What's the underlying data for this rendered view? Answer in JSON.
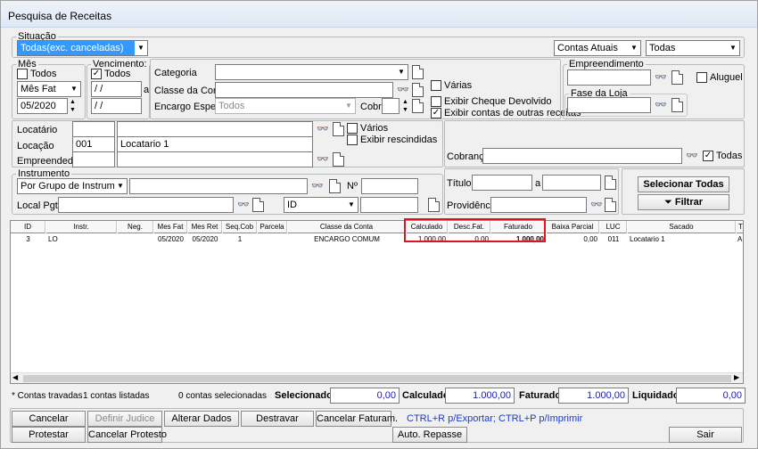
{
  "window": {
    "title": "Pesquisa de Receitas"
  },
  "situacao": {
    "legend": "Situação",
    "value": "Todas(exc. canceladas)",
    "contas_value": "Contas Atuais",
    "todas_value": "Todas"
  },
  "mes": {
    "legend": "Mês",
    "todos_label": "Todos",
    "tipo_value": "Mês Fat",
    "mes_value": "05/2020"
  },
  "vencimento": {
    "legend": "Vencimento:",
    "todos_label": "Todos",
    "de_value": "/ /",
    "ate_sep": "a",
    "ate_value": "/ /"
  },
  "categoria": {
    "categoria_label": "Categoria",
    "classe_label": "Classe da Conta",
    "encargo_label": "Encargo Espec.",
    "encargo_value": "Todos",
    "cobr_label": "Cobr",
    "varias_label": "Várias",
    "cheque_label": "Exibir Cheque Devolvido",
    "outras_label": "Exibir contas de outras receitas"
  },
  "empreendimento": {
    "legend": "Empreendimento",
    "aluguel_label": "Aluguel",
    "fase_legend": "Fase da Loja"
  },
  "locatario": {
    "locatario_label": "Locatário",
    "locacao_label": "Locação",
    "locacao_id": "001",
    "locacao_name": "Locatario 1",
    "empreendedor_label": "Empreendedor",
    "varios_label": "Vários",
    "rescindidas_label": "Exibir rescindidas"
  },
  "cobranca": {
    "label": "Cobrança",
    "todas_label": "Todas"
  },
  "instrumento": {
    "legend": "Instrumento",
    "value": "Por Grupo de Instrumento",
    "numero_label": "Nº",
    "local_label": "Local Pgto",
    "id_value": "ID"
  },
  "titulo": {
    "titulo_label": "Título",
    "sep": "a",
    "providencia_label": "Providência"
  },
  "actions": {
    "selecionar_todas": "Selecionar Todas",
    "filtrar": "Filtrar"
  },
  "grid": {
    "columns": [
      "ID",
      "Instr.",
      "Neg.",
      "Mes Fat",
      "Mes Ret",
      "Seq.Cob",
      "Parcela",
      "Classe da Conta",
      "Calculado",
      "Desc.Fat.",
      "Faturado",
      "Baixa Parcial",
      "LUC",
      "Sacado",
      "T"
    ],
    "rows": [
      {
        "id": "3",
        "instr": "LO",
        "neg": "",
        "mes_fat": "05/2020",
        "mes_ret": "05/2020",
        "seq_cob": "1",
        "parcela": "",
        "classe": "ENCARGO COMUM",
        "calculado": "1.000,00",
        "desc_fat": "0,00",
        "faturado": "1.000,00",
        "baixa_parcial": "0,00",
        "luc": "011",
        "sacado": "Locatario 1",
        "t": "A"
      }
    ]
  },
  "footer": {
    "travadas": "* Contas travadas",
    "listadas": "1 contas listadas",
    "selecionadas": "0 contas selecionadas",
    "selecionado_label": "Selecionado",
    "selecionado_value": "0,00",
    "calculado_label": "Calculado",
    "calculado_value": "1.000,00",
    "faturado_label": "Faturado",
    "faturado_value": "1.000,00",
    "liquidado_label": "Liquidado",
    "liquidado_value": "0,00"
  },
  "buttons": {
    "cancelar": "Cancelar",
    "definir_judice": "Definir Judice",
    "alterar_dados": "Alterar Dados",
    "destravar": "Destravar",
    "cancelar_faturam": "Cancelar Faturam.",
    "shortcuts": "CTRL+R p/Exportar; CTRL+P p/Imprimir",
    "protestar": "Protestar",
    "cancelar_protesto": "Cancelar Protesto",
    "auto_repasse": "Auto. Repasse",
    "sair": "Sair"
  },
  "colors": {
    "highlight": "#e0141e",
    "selection": "#3399ff",
    "value_text": "#2020b0"
  }
}
